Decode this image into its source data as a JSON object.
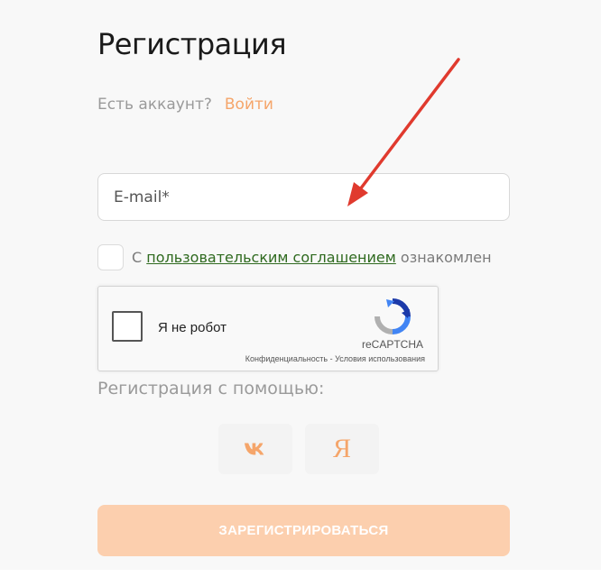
{
  "header": {
    "title": "Регистрация"
  },
  "login": {
    "prompt": "Есть аккаунт?",
    "link": "Войти"
  },
  "email": {
    "placeholder": "E-mail*",
    "value": ""
  },
  "agreement": {
    "prefix": "С",
    "link": "пользовательским соглашением",
    "suffix": "ознакомлен",
    "checked": false
  },
  "recaptcha": {
    "label": "Я не робот",
    "brand": "reCAPTCHA",
    "privacy": "Конфиденциальность",
    "separator": "-",
    "terms": "Условия использования"
  },
  "social": {
    "label": "Регистрация с помощью:",
    "buttons": [
      {
        "provider": "vk",
        "icon": "vk-logo-icon"
      },
      {
        "provider": "yandex",
        "icon": "yandex-logo-icon",
        "glyph": "Я"
      }
    ]
  },
  "submit": {
    "label": "ЗАРЕГИСТРИРОВАТЬСЯ"
  },
  "colors": {
    "accent": "#f5a56a",
    "submit_bg": "#fccfae",
    "link_green": "#2f6a1f",
    "annotation_arrow": "#e03a2e"
  },
  "annotation": {
    "type": "arrow",
    "target": "email-input"
  }
}
